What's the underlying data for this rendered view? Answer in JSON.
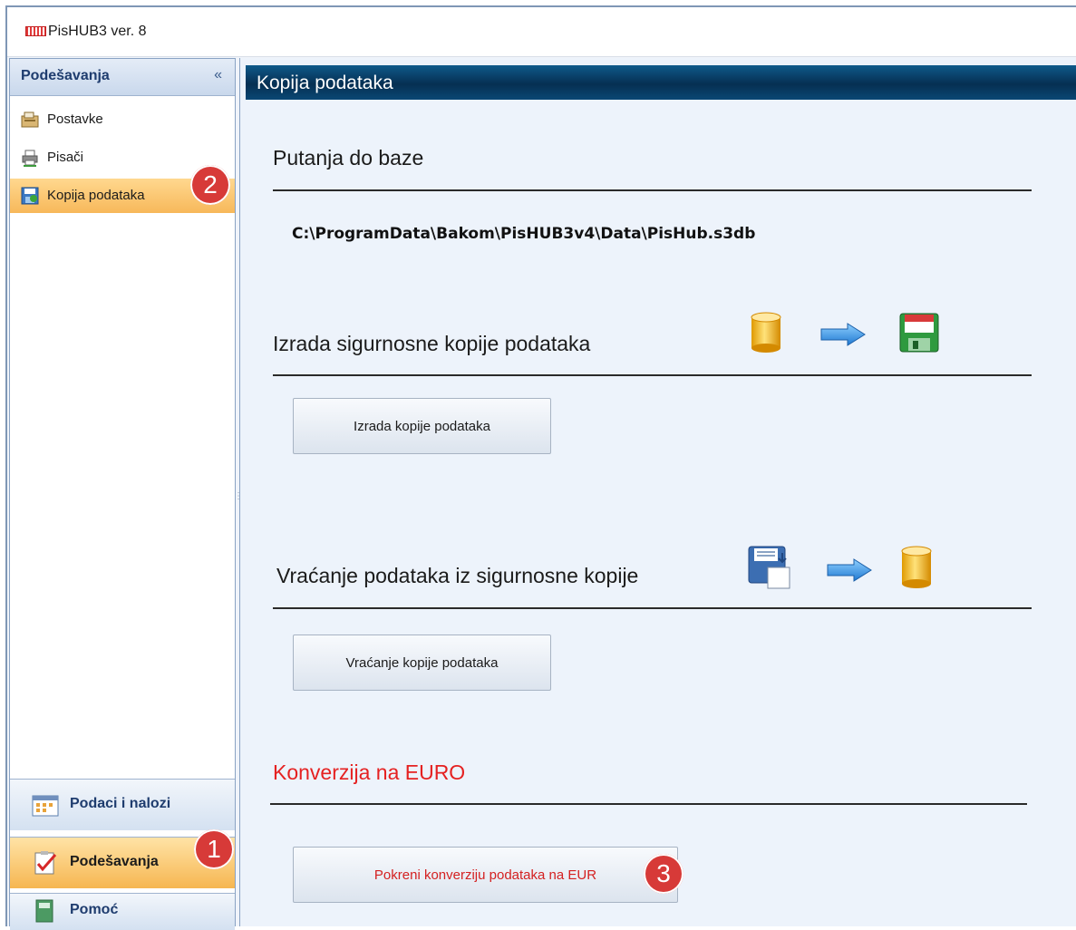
{
  "window": {
    "title": "PisHUB3 ver. 8"
  },
  "sidebar": {
    "header": "Podešavanja",
    "collapse_glyph": "«",
    "items": [
      {
        "label": "Postavke",
        "icon": "settings-icon"
      },
      {
        "label": "Pisači",
        "icon": "printer-icon"
      },
      {
        "label": "Kopija podataka",
        "icon": "backup-icon",
        "active": true
      }
    ],
    "nav_buttons": [
      {
        "label": "Podaci i nalozi",
        "icon": "calendar-icon"
      },
      {
        "label": "Podešavanja",
        "icon": "checklist-icon",
        "active": true
      },
      {
        "label": "Pomoć",
        "icon": "help-icon"
      }
    ]
  },
  "main": {
    "header": "Kopija podataka",
    "db_path_title": "Putanja do baze",
    "db_path": "C:\\ProgramData\\Bakom\\PisHUB3v4\\Data\\PisHub.s3db",
    "backup_title": "Izrada sigurnosne kopije podataka",
    "backup_button": "Izrada kopije podataka",
    "restore_title": "Vraćanje podataka iz sigurnosne kopije",
    "restore_button": "Vraćanje kopije podataka",
    "euro_title": "Konverzija na EURO",
    "euro_button": "Pokreni konverziju podataka na EUR"
  },
  "badges": {
    "one": "1",
    "two": "2",
    "three": "3"
  },
  "colors": {
    "accent_orange": "#f7b85a",
    "header_blue": "#062f52",
    "badge_red": "#d73a38",
    "euro_red": "#e52121"
  }
}
